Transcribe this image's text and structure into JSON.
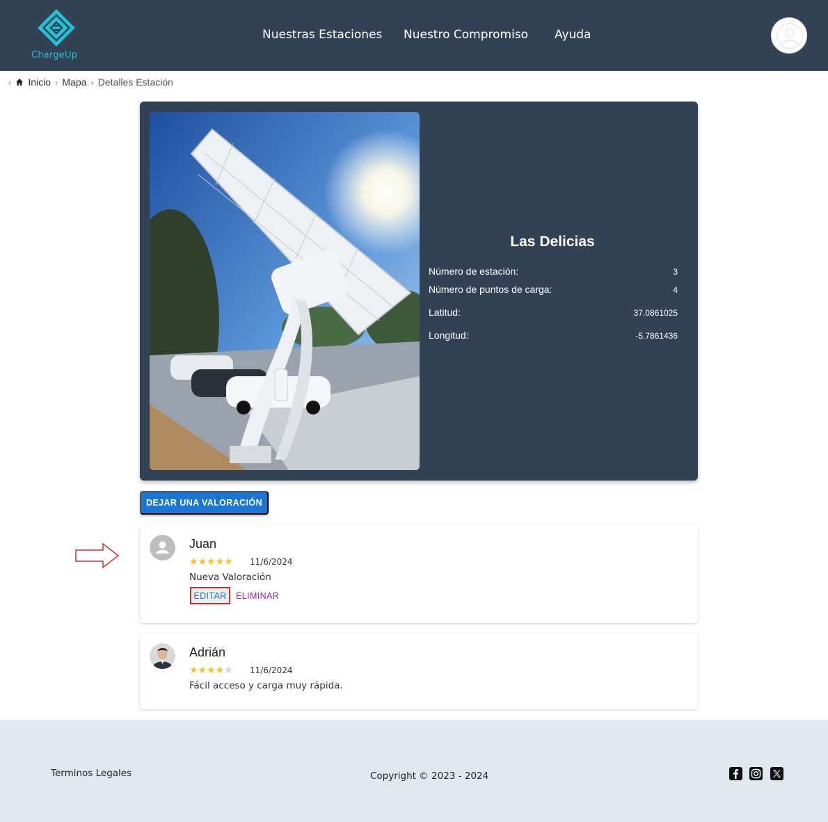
{
  "brand": {
    "name": "ChargeUp",
    "accent": "#22c3d6"
  },
  "nav": {
    "items": [
      {
        "label": "Nuestras Estaciones"
      },
      {
        "label": "Nuestro Compromiso"
      },
      {
        "label": "Ayuda"
      }
    ]
  },
  "breadcrumb": {
    "home": "Inicio",
    "map": "Mapa",
    "current": "Detalles Estación"
  },
  "station": {
    "name": "Las Delicias",
    "fields": [
      {
        "label": "Número de estación:",
        "value": "3"
      },
      {
        "label": "Número de puntos de carga:",
        "value": "4"
      },
      {
        "label": "Latitud:",
        "value": "37.0861025"
      },
      {
        "label": "Longitud:",
        "value": "-5.7861436"
      }
    ]
  },
  "actions": {
    "leave_review": "DEJAR UNA VALORACIÓN"
  },
  "reviews": [
    {
      "author": "Juan",
      "rating": 5,
      "date": "11/6/2024",
      "text": "Nueva Valoración",
      "edit_label": "EDITAR",
      "delete_label": "ELIMINAR"
    },
    {
      "author": "Adrián",
      "rating": 4,
      "date": "11/6/2024",
      "text": "Fácil acceso y carga muy rápida."
    }
  ],
  "footer": {
    "legal": "Terminos Legales",
    "copyright": "Copyright © 2023 - 2024",
    "social": [
      "facebook-icon",
      "instagram-icon",
      "x-icon"
    ]
  },
  "colors": {
    "header_bg": "#334155",
    "primary": "#1976d2",
    "danger_outline": "#d32f2f",
    "secondary": "#9c27b0",
    "star": "#fbbf24",
    "footer_bg": "#e2e8f0"
  }
}
